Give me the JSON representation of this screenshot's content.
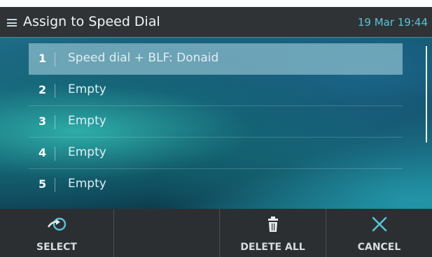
{
  "header": {
    "title": "Assign to Speed Dial",
    "datetime": "19 Mar 19:44",
    "menu_icon": "list-menu-icon"
  },
  "list": {
    "selected_index": 0,
    "items": [
      {
        "number": "1",
        "label": "Speed dial + BLF: Donaid"
      },
      {
        "number": "2",
        "label": "Empty"
      },
      {
        "number": "3",
        "label": "Empty"
      },
      {
        "number": "4",
        "label": "Empty"
      },
      {
        "number": "5",
        "label": "Empty"
      }
    ]
  },
  "softkeys": {
    "select": {
      "label": "SELECT",
      "icon": "select-arrow-icon"
    },
    "empty": {
      "label": ""
    },
    "delete_all": {
      "label": "DELETE ALL",
      "icon": "trash-icon"
    },
    "cancel": {
      "label": "CANCEL",
      "icon": "close-icon"
    }
  },
  "colors": {
    "accent": "#58c4d8",
    "header_bg": "#2f3336",
    "softkey_bg": "#2b2f32",
    "selected_row": "#a0cdda",
    "pointer_arrow": "#1a2bd6"
  }
}
